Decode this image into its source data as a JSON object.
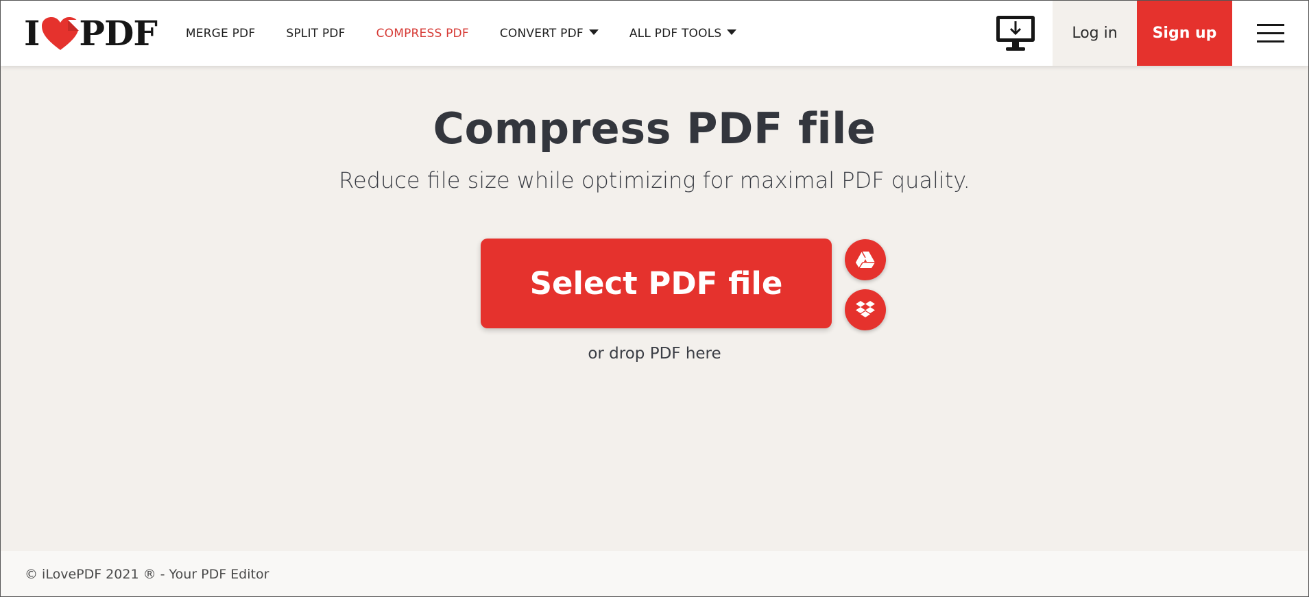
{
  "header": {
    "logo": {
      "left": "I",
      "right": "PDF"
    },
    "nav": [
      {
        "label": "MERGE PDF",
        "active": false,
        "dropdown": false
      },
      {
        "label": "SPLIT PDF",
        "active": false,
        "dropdown": false
      },
      {
        "label": "COMPRESS PDF",
        "active": true,
        "dropdown": false
      },
      {
        "label": "CONVERT PDF",
        "active": false,
        "dropdown": true
      },
      {
        "label": "ALL PDF TOOLS",
        "active": false,
        "dropdown": true
      }
    ],
    "desktop_icon": "desktop-download-icon",
    "login_label": "Log in",
    "signup_label": "Sign up",
    "menu_icon": "hamburger-menu-icon"
  },
  "main": {
    "title": "Compress PDF file",
    "subtitle": "Reduce file size while optimizing for maximal PDF quality.",
    "select_label": "Select PDF file",
    "cloud_buttons": [
      "google-drive-icon",
      "dropbox-icon"
    ],
    "drop_hint": "or drop PDF here"
  },
  "footer": {
    "copyright": "© iLovePDF 2021 ® - Your PDF Editor"
  },
  "colors": {
    "brand_red": "#e5322d",
    "active_nav": "#d63a35",
    "background": "#f3f0ec",
    "text_dark": "#33363d"
  }
}
